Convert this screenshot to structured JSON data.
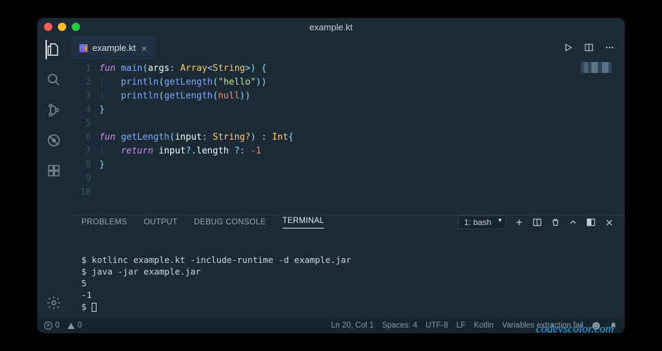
{
  "window": {
    "title": "example.kt"
  },
  "tab": {
    "filename": "example.kt"
  },
  "code_lines": [
    [
      [
        "kw",
        "fun"
      ],
      [
        "plain",
        " "
      ],
      [
        "fn",
        "main"
      ],
      [
        "punc",
        "("
      ],
      [
        "id",
        "args"
      ],
      [
        "punc",
        ": "
      ],
      [
        "type",
        "Array"
      ],
      [
        "punc",
        "<"
      ],
      [
        "type",
        "String"
      ],
      [
        "punc",
        ">) {"
      ]
    ],
    [
      [
        "plain",
        "    "
      ],
      [
        "fn",
        "println"
      ],
      [
        "punc",
        "("
      ],
      [
        "fn",
        "getLength"
      ],
      [
        "punc",
        "("
      ],
      [
        "str",
        "\"hello\""
      ],
      [
        "punc",
        "))"
      ]
    ],
    [
      [
        "plain",
        "    "
      ],
      [
        "fn",
        "println"
      ],
      [
        "punc",
        "("
      ],
      [
        "fn",
        "getLength"
      ],
      [
        "punc",
        "("
      ],
      [
        "null",
        "null"
      ],
      [
        "punc",
        "))"
      ]
    ],
    [
      [
        "punc",
        "}"
      ]
    ],
    [],
    [
      [
        "kw",
        "fun"
      ],
      [
        "plain",
        " "
      ],
      [
        "fn",
        "getLength"
      ],
      [
        "punc",
        "("
      ],
      [
        "id",
        "input"
      ],
      [
        "punc",
        ": "
      ],
      [
        "type",
        "String?"
      ],
      [
        "punc",
        ") : "
      ],
      [
        "type",
        "Int"
      ],
      [
        "punc",
        "{"
      ]
    ],
    [
      [
        "plain",
        "    "
      ],
      [
        "kw",
        "return"
      ],
      [
        "plain",
        " "
      ],
      [
        "id",
        "input"
      ],
      [
        "punc",
        "?."
      ],
      [
        "id",
        "length"
      ],
      [
        "punc",
        " ?: "
      ],
      [
        "num",
        "-1"
      ]
    ],
    [
      [
        "punc",
        "}"
      ]
    ],
    [],
    []
  ],
  "panel": {
    "tabs": [
      "PROBLEMS",
      "OUTPUT",
      "DEBUG CONSOLE",
      "TERMINAL"
    ],
    "active_tab": "TERMINAL",
    "terminal_selector": "1: bash",
    "terminal_lines": [
      "$ kotlinc example.kt -include-runtime -d example.jar",
      "$ java -jar example.jar",
      "5",
      "-1",
      "$ "
    ]
  },
  "watermark": "codevscolor.com",
  "status": {
    "errors": "0",
    "warnings": "0",
    "cursor": "Ln 20, Col 1",
    "spaces": "Spaces: 4",
    "encoding": "UTF-8",
    "eol": "LF",
    "language": "Kotlin",
    "extra": "Variables extraction fail"
  }
}
